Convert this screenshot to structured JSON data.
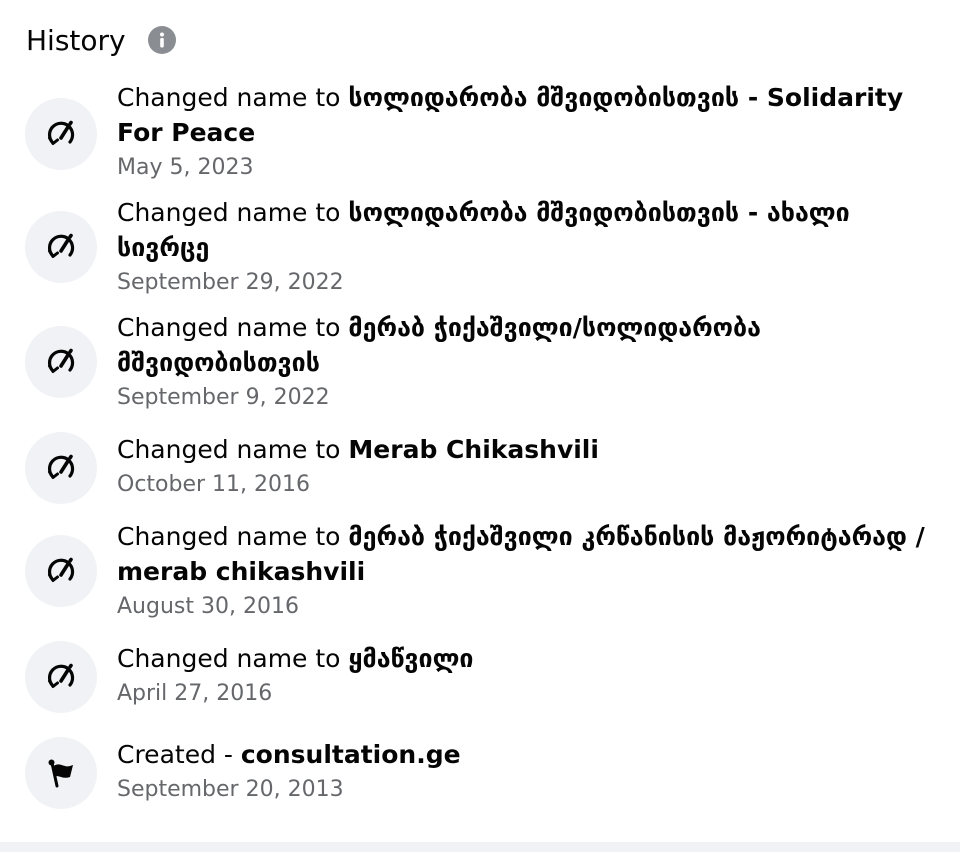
{
  "header": {
    "title": "History",
    "info_icon": "info-icon"
  },
  "items": [
    {
      "icon": "pencil-edit-icon",
      "prefix": "Changed name to ",
      "name": "სოლიდარობა მშვიდობისთვის - Solidarity For Peace",
      "date": "May 5, 2023"
    },
    {
      "icon": "pencil-edit-icon",
      "prefix": "Changed name to ",
      "name": "სოლიდარობა მშვიდობისთვის - ახალი სივრცე",
      "date": "September 29, 2022"
    },
    {
      "icon": "pencil-edit-icon",
      "prefix": "Changed name to ",
      "name": "მერაბ ჭიქაშვილი/სოლიდარობა მშვიდობისთვის",
      "date": "September 9, 2022"
    },
    {
      "icon": "pencil-edit-icon",
      "prefix": "Changed name to ",
      "name": "Merab Chikashvili",
      "date": "October 11, 2016"
    },
    {
      "icon": "pencil-edit-icon",
      "prefix": "Changed name to ",
      "name": "მერაბ ჭიქაშვილი კრწანისის მაჟორიტარად / merab chikashvili",
      "date": "August 30, 2016"
    },
    {
      "icon": "pencil-edit-icon",
      "prefix": "Changed name to ",
      "name": "ყმაწვილი",
      "date": "April 27, 2016"
    },
    {
      "icon": "flag-icon",
      "prefix": "Created - ",
      "name": "consultation.ge",
      "date": "September 20, 2013"
    }
  ]
}
